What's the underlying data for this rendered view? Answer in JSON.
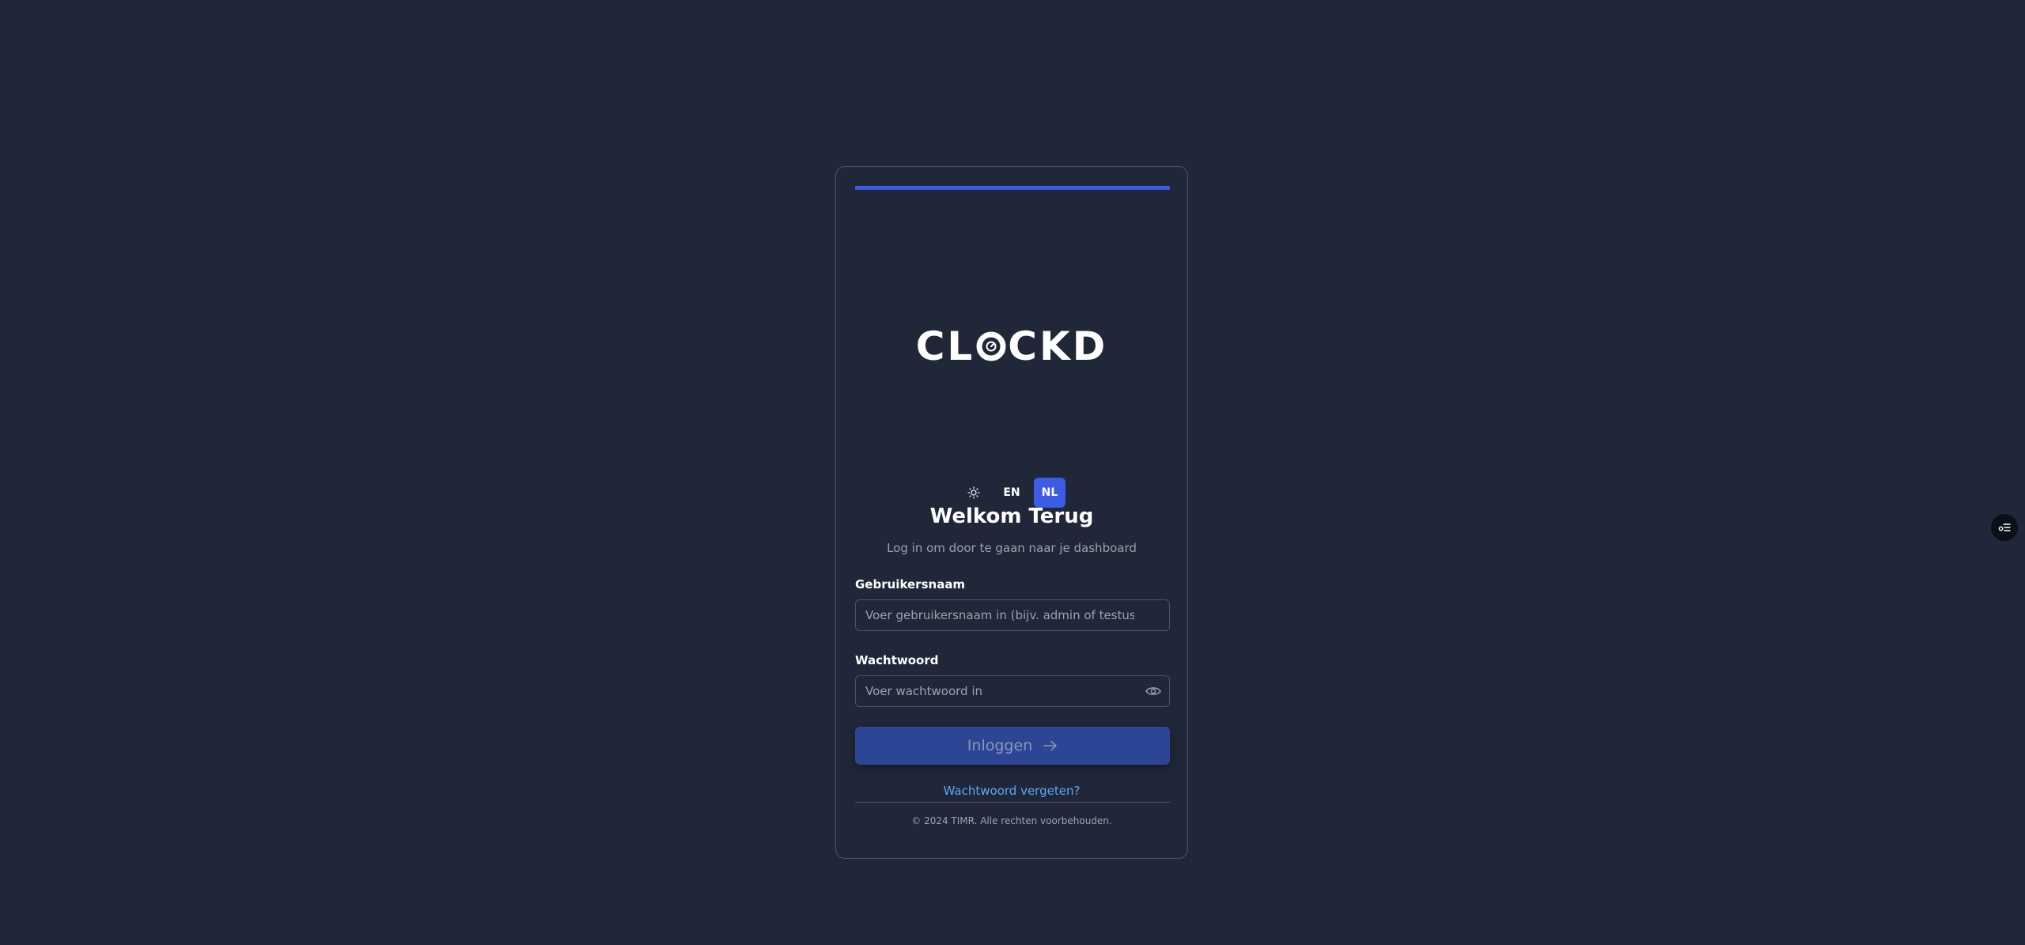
{
  "app": {
    "logo_text_left": "CL",
    "logo_text_right": "CKD",
    "logo_o_icon": "clock-o-icon"
  },
  "toggles": {
    "theme_icon": "sun-icon",
    "lang_en": "EN",
    "lang_nl": "NL",
    "active_lang": "NL"
  },
  "header": {
    "title": "Welkom Terug",
    "subtitle": "Log in om door te gaan naar je dashboard"
  },
  "form": {
    "username_label": "Gebruikersnaam",
    "username_placeholder": "Voer gebruikersnaam in (bijv. admin of testuser)",
    "password_label": "Wachtwoord",
    "password_placeholder": "Voer wachtwoord in",
    "password_toggle_icon": "eye-icon",
    "submit_label": "Inloggen",
    "submit_icon": "arrow-right-icon",
    "forgot_link": "Wachtwoord vergeten?"
  },
  "footer": {
    "copyright": "© 2024 TIMR. Alle rechten voorbehouden."
  },
  "floating": {
    "icon": "settings-list-icon"
  },
  "colors": {
    "background": "#1f2738",
    "accent": "#3b5ce3",
    "button_disabled": "#2c4594",
    "link": "#60a5fa",
    "border": "#4b5563"
  }
}
